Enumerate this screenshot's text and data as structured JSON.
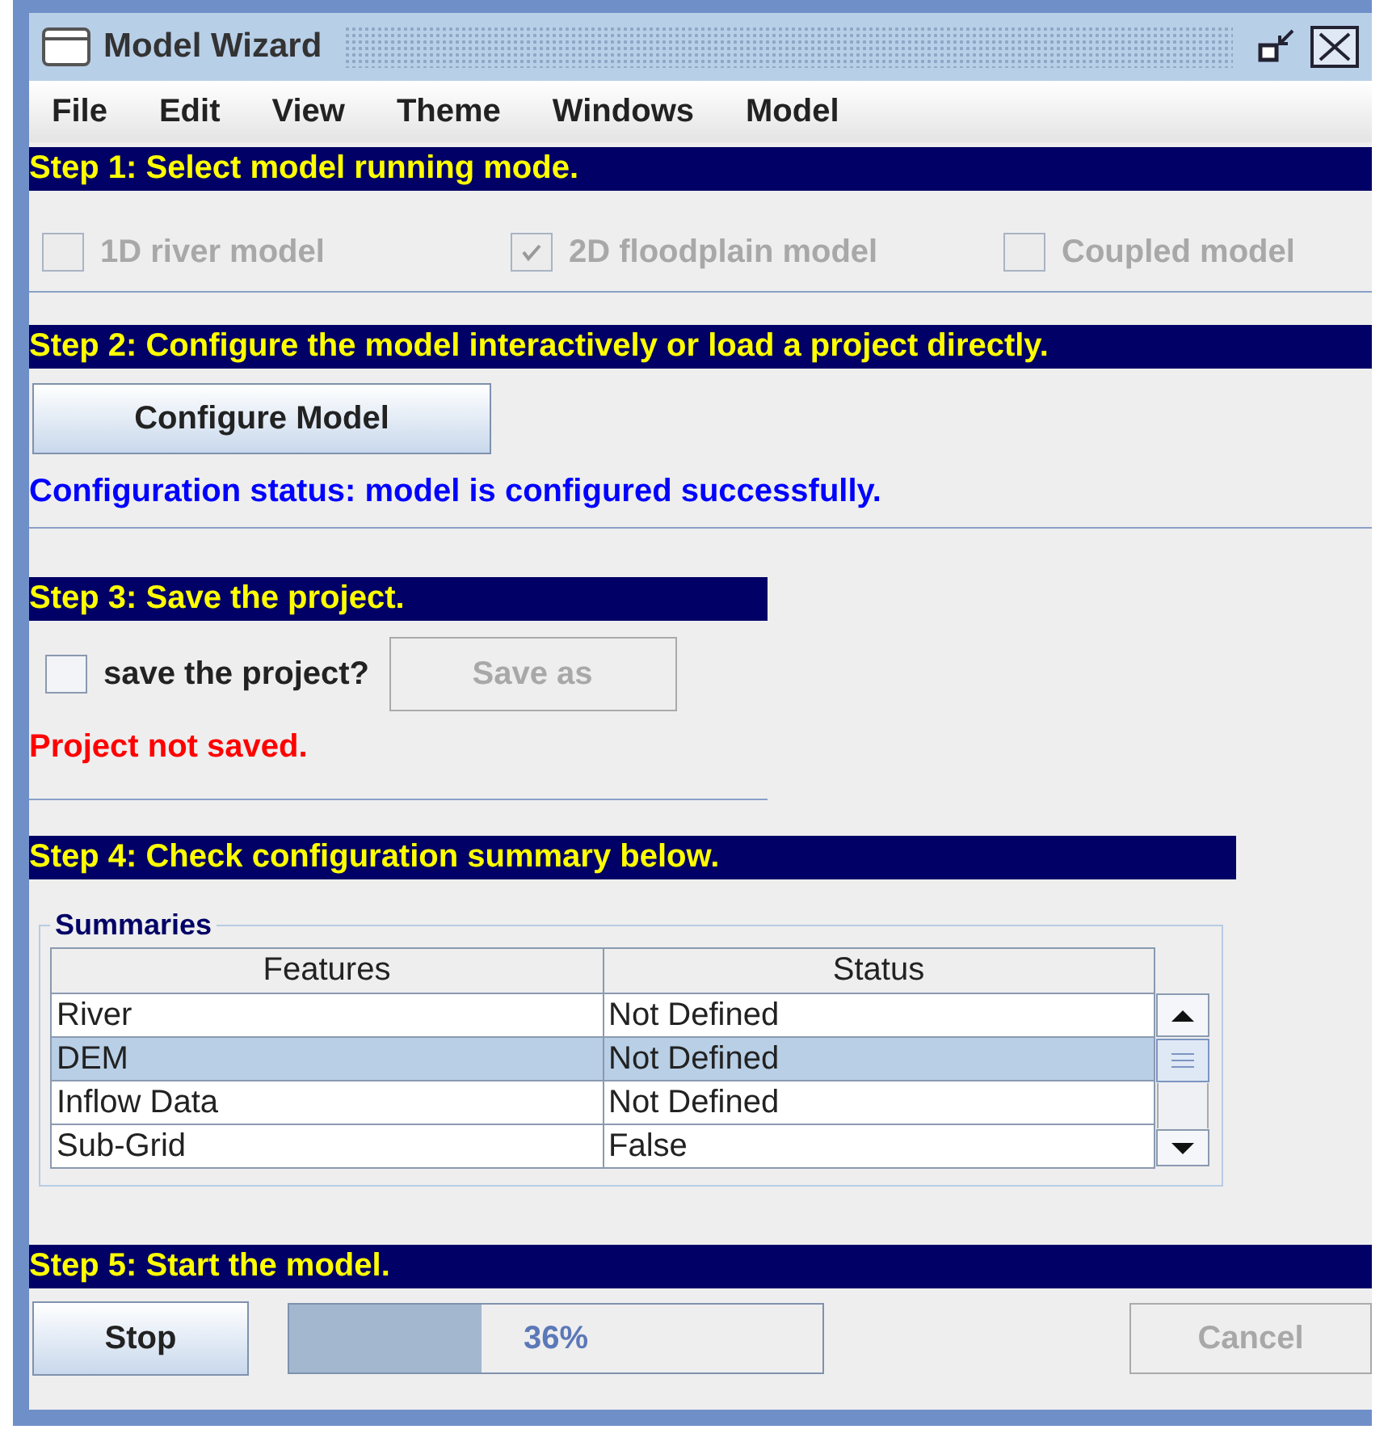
{
  "window": {
    "title": "Model Wizard"
  },
  "menu": [
    "File",
    "Edit",
    "View",
    "Theme",
    "Windows",
    "Model"
  ],
  "step1": {
    "header": "Step 1: Select model running mode.",
    "modes": [
      {
        "label": "1D river model",
        "checked": false,
        "disabled": true
      },
      {
        "label": "2D floodplain model",
        "checked": true,
        "disabled": true
      },
      {
        "label": "Coupled model",
        "checked": false,
        "disabled": true
      }
    ]
  },
  "step2": {
    "header": "Step 2: Configure the model interactively or load a project directly.",
    "button": "Configure Model",
    "status": "Configuration status: model is configured successfully."
  },
  "step3": {
    "header": "Step 3: Save the project.",
    "save_checkbox": {
      "label": "save the project?",
      "checked": false
    },
    "save_button": {
      "label": "Save as",
      "disabled": true
    },
    "status": "Project not saved."
  },
  "step4": {
    "header": "Step 4: Check configuration summary below.",
    "group_title": "Summaries",
    "table": {
      "columns": [
        "Features",
        "Status"
      ],
      "rows": [
        {
          "cells": [
            "River",
            "Not Defined"
          ],
          "selected": false
        },
        {
          "cells": [
            "DEM",
            "Not Defined"
          ],
          "selected": true
        },
        {
          "cells": [
            "Inflow Data",
            "Not Defined"
          ],
          "selected": false
        },
        {
          "cells": [
            "Sub-Grid",
            "False"
          ],
          "selected": false
        }
      ]
    }
  },
  "step5": {
    "header": "Step 5: Start the model.",
    "stop_button": "Stop",
    "progress": {
      "level": 0.36,
      "reading": "36%"
    },
    "cancel_button": {
      "label": "Cancel",
      "disabled": true
    }
  }
}
